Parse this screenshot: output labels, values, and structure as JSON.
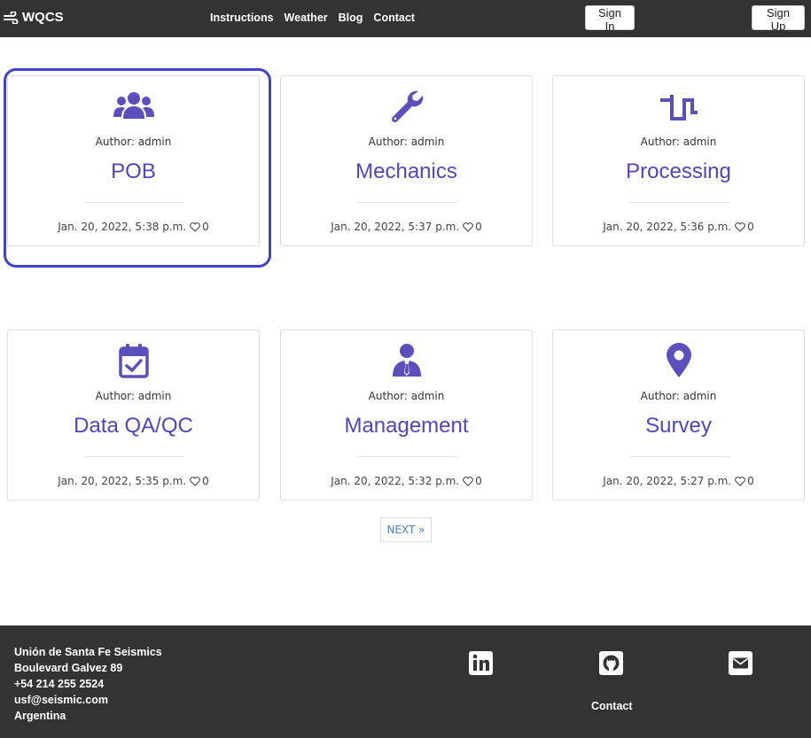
{
  "header": {
    "brand": "WQCS",
    "nav": [
      "Instructions",
      "Weather",
      "Blog",
      "Contact"
    ],
    "signin_label": "Sign In",
    "signup_label": "Sign Up"
  },
  "posts": [
    {
      "icon": "users-icon",
      "author": "Author: admin",
      "title": "POB",
      "date": "Jan. 20, 2022, 5:38 p.m.",
      "likes": "0"
    },
    {
      "icon": "wrench-icon",
      "author": "Author: admin",
      "title": "Mechanics",
      "date": "Jan. 20, 2022, 5:37 p.m.",
      "likes": "0"
    },
    {
      "icon": "square-wave-icon",
      "author": "Author: admin",
      "title": "Processing",
      "date": "Jan. 20, 2022, 5:36 p.m.",
      "likes": "0"
    },
    {
      "icon": "calendar-check-icon",
      "author": "Author: admin",
      "title": "Data QA/QC",
      "date": "Jan. 20, 2022, 5:35 p.m.",
      "likes": "0"
    },
    {
      "icon": "user-tie-icon",
      "author": "Author: admin",
      "title": "Management",
      "date": "Jan. 20, 2022, 5:32 p.m.",
      "likes": "0"
    },
    {
      "icon": "map-marker-icon",
      "author": "Author: admin",
      "title": "Survey",
      "date": "Jan. 20, 2022, 5:27 p.m.",
      "likes": "0"
    }
  ],
  "pagination": {
    "next_label": "NEXT »"
  },
  "footer": {
    "address": [
      "Unión de Santa Fe Seismics",
      "Boulevard Galvez 89",
      "+54 214 255 2524",
      "usf@seismic.com",
      "Argentina"
    ],
    "contact_label": "Contact"
  },
  "colors": {
    "accent": "#4f46c0",
    "icon": "#5b4fbd",
    "nav_bg": "#333333",
    "focus_ring": "#3f44c3",
    "link": "#4a7fd6"
  }
}
